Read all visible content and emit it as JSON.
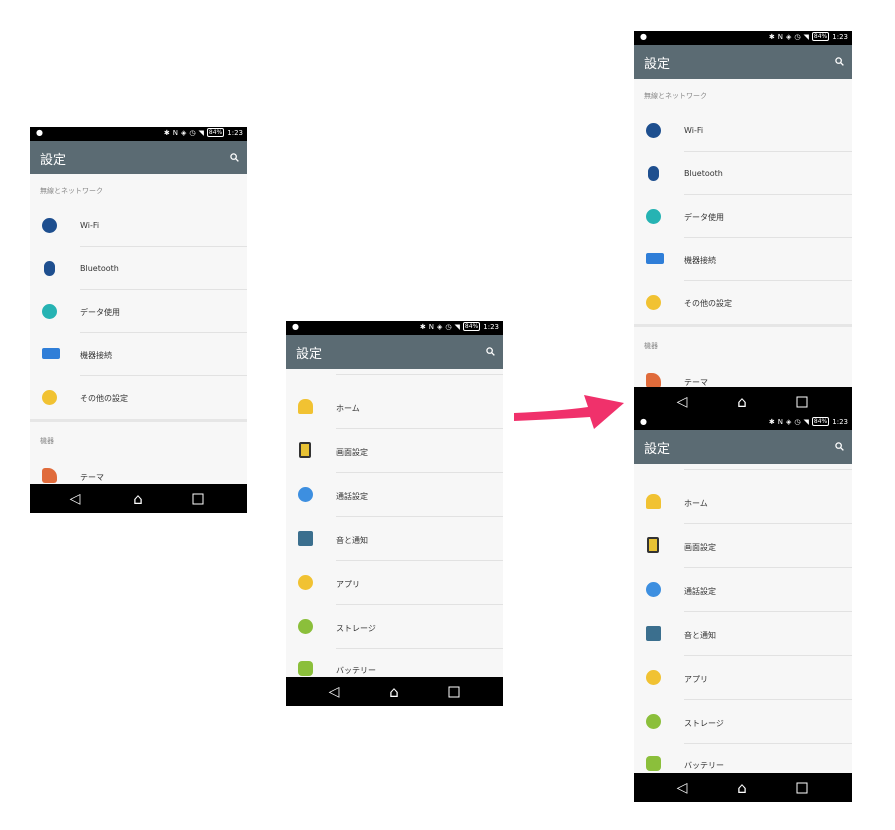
{
  "status": {
    "battery": "84%",
    "time": "1:23"
  },
  "appbar": {
    "title": "設定"
  },
  "section_network": "無線とネットワーク",
  "section_device": "機器",
  "network_items": [
    {
      "label": "Wi-Fi",
      "icon": "wifi-icon",
      "color": "#1e4f8f"
    },
    {
      "label": "Bluetooth",
      "icon": "bluetooth-icon",
      "color": "#1e4f8f"
    },
    {
      "label": "データ使用",
      "icon": "data-usage-icon",
      "color": "#26b3b3"
    },
    {
      "label": "機器接続",
      "icon": "device-connection-icon",
      "color": "#2f7ed8"
    },
    {
      "label": "その他の設定",
      "icon": "more-settings-icon",
      "color": "#f1c232"
    }
  ],
  "device_items": [
    {
      "label": "テーマ",
      "icon": "theme-icon",
      "color": "#e06b3b"
    }
  ],
  "device_items_2": [
    {
      "label": "ホーム",
      "icon": "home-icon",
      "color": "#f1c232"
    },
    {
      "label": "画面設定",
      "icon": "display-icon",
      "color": "#e8c234"
    },
    {
      "label": "通話設定",
      "icon": "call-settings-icon",
      "color": "#3d8fe0"
    },
    {
      "label": "音と通知",
      "icon": "sound-icon",
      "color": "#3b6f8e"
    },
    {
      "label": "アプリ",
      "icon": "apps-icon",
      "color": "#f1c232"
    },
    {
      "label": "ストレージ",
      "icon": "storage-icon",
      "color": "#8bbf3b"
    },
    {
      "label": "バッテリー",
      "icon": "battery-icon",
      "color": "#8bbf3b"
    }
  ],
  "arrow_color": "#f0316b"
}
